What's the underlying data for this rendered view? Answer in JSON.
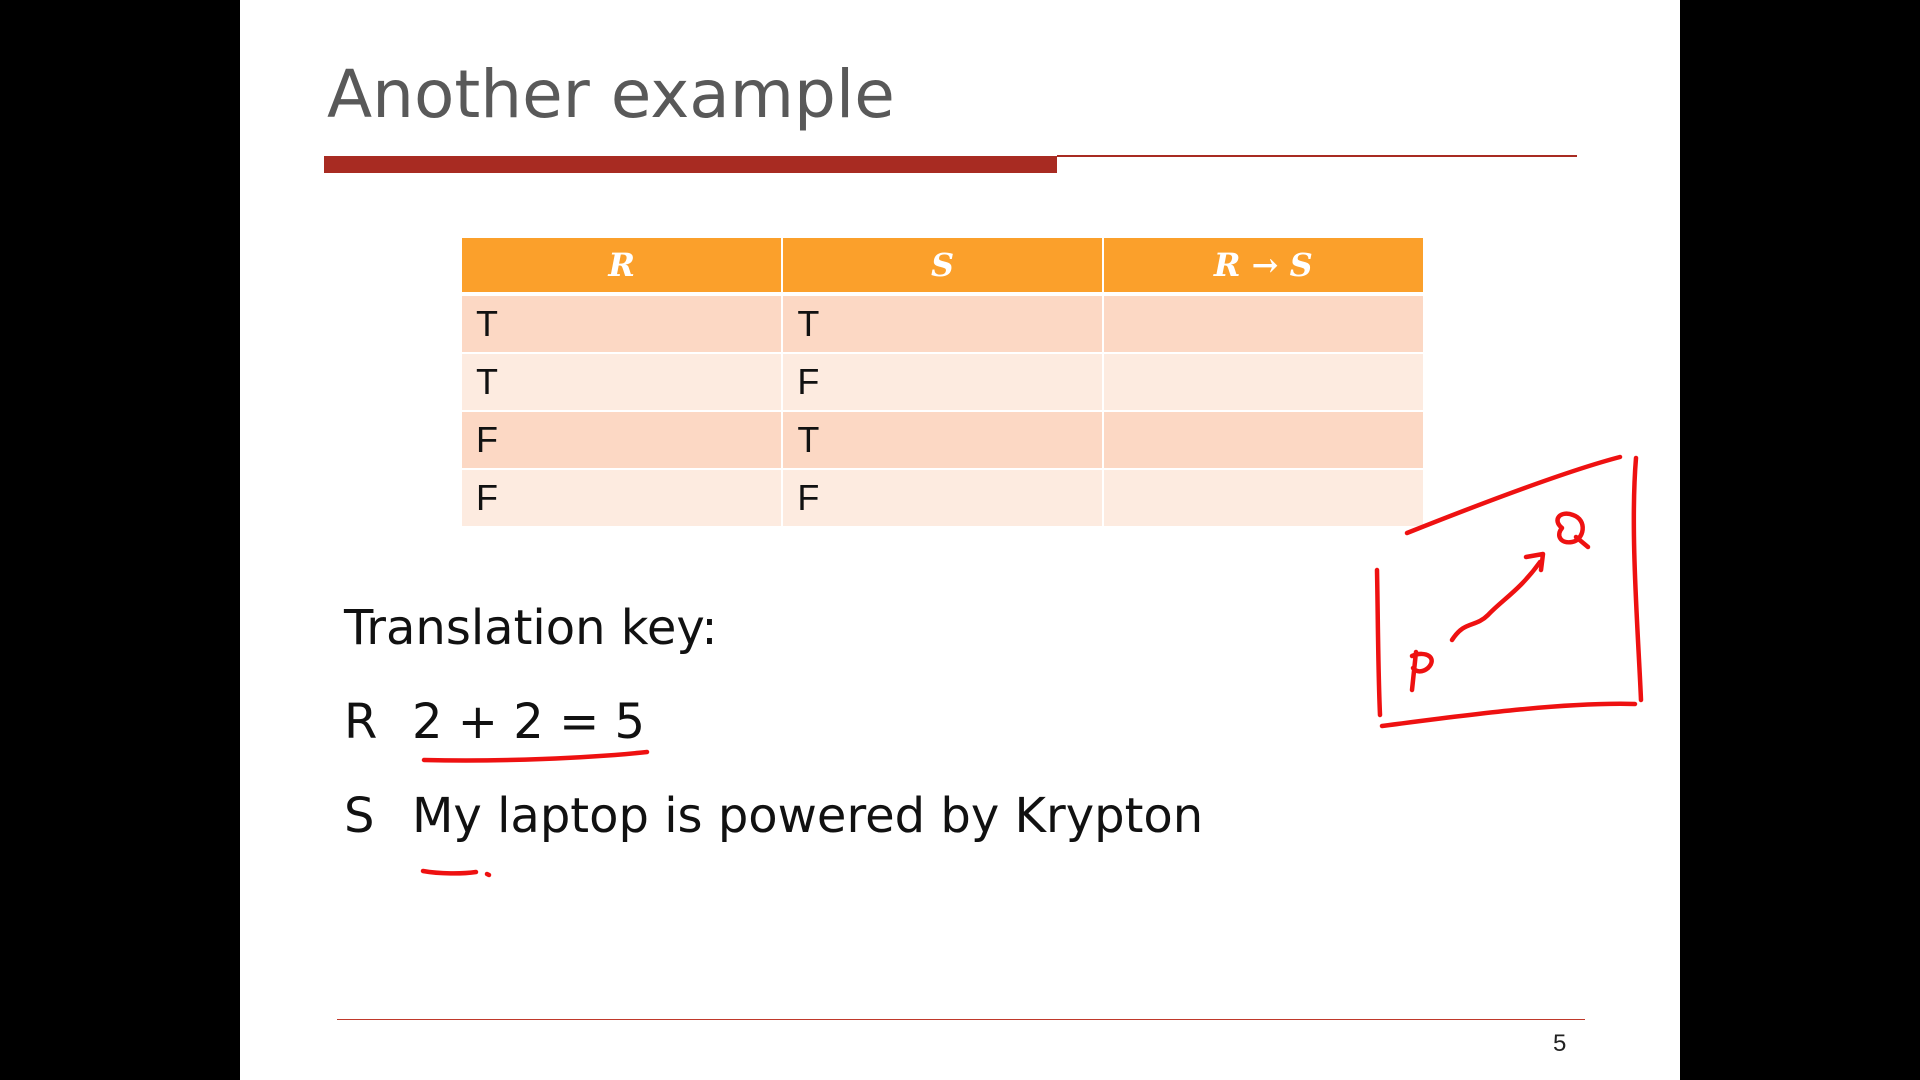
{
  "slide": {
    "title": "Another example",
    "page_number": "5"
  },
  "table": {
    "headers": [
      "R",
      "S",
      "R → S"
    ],
    "rows": [
      [
        "T",
        "T",
        ""
      ],
      [
        "T",
        "F",
        ""
      ],
      [
        "F",
        "T",
        ""
      ],
      [
        "F",
        "F",
        ""
      ]
    ]
  },
  "translation_key": {
    "heading": "Translation key:",
    "items": [
      {
        "letter": "R",
        "text": "2 + 2 = 5"
      },
      {
        "letter": "S",
        "text": "My laptop is powered by Krypton"
      }
    ]
  },
  "colors": {
    "title": "#595959",
    "accent_rule": "#a82b22",
    "table_header": "#fba02b",
    "row_odd": "#fcd8c4",
    "row_even": "#fdebe0",
    "annotation_ink": "#ee1111"
  },
  "annotations": {
    "ink_labels": [
      "P",
      "Q"
    ]
  }
}
